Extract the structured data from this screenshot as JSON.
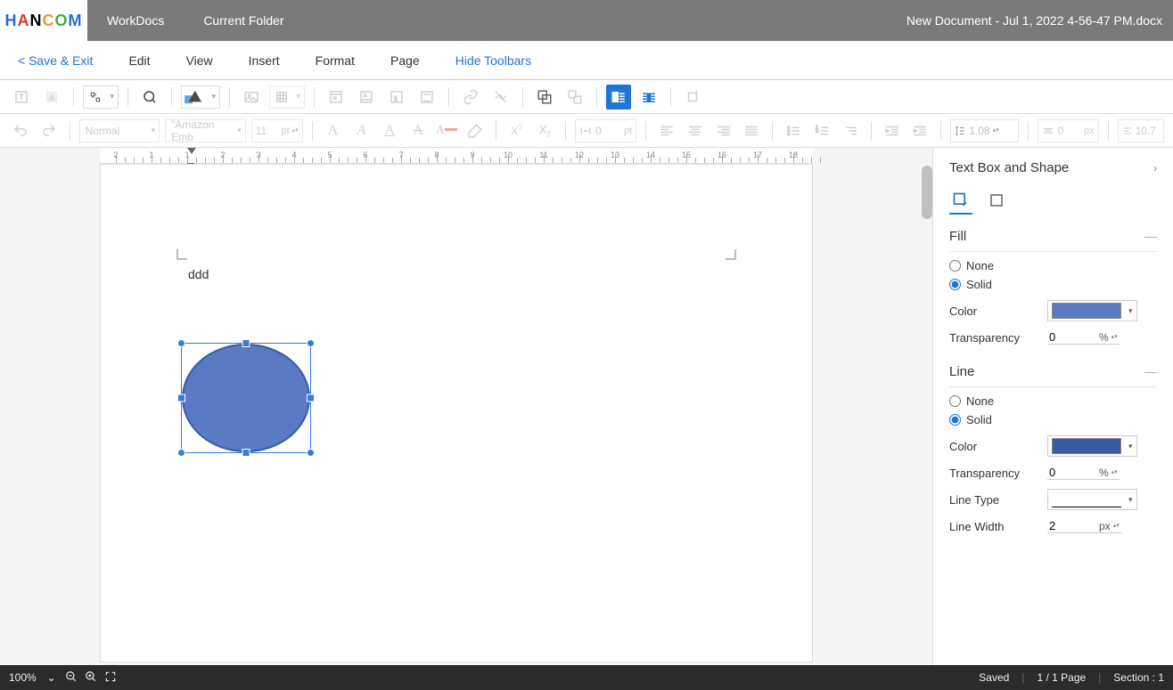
{
  "titlebar": {
    "workdocs": "WorkDocs",
    "current_folder": "Current Folder",
    "doc_title": "New Document - Jul 1, 2022 4-56-47 PM.docx"
  },
  "menubar": {
    "save_exit": "< Save & Exit",
    "edit": "Edit",
    "view": "View",
    "insert": "Insert",
    "format": "Format",
    "page": "Page",
    "hide_toolbars": "Hide Toolbars"
  },
  "toolbar2": {
    "style": "Normal",
    "font": "\"Amazon Emb",
    "size": "11",
    "size_unit": "pt",
    "letter_spacing": "0",
    "ls_unit": "pt",
    "line_height": "1.08",
    "indent": "0",
    "indent_unit": "px",
    "right_val": "10.7"
  },
  "document": {
    "text": "ddd"
  },
  "sidepanel": {
    "title": "Text Box and Shape",
    "fill": {
      "heading": "Fill",
      "none": "None",
      "solid": "Solid",
      "color_label": "Color",
      "color_value": "#5a7bc4",
      "transparency_label": "Transparency",
      "transparency_value": "0",
      "transparency_unit": "%"
    },
    "line": {
      "heading": "Line",
      "none": "None",
      "solid": "Solid",
      "color_label": "Color",
      "color_value": "#3a5ba4",
      "transparency_label": "Transparency",
      "transparency_value": "0",
      "transparency_unit": "%",
      "line_type_label": "Line Type",
      "line_width_label": "Line Width",
      "line_width_value": "2",
      "line_width_unit": "px"
    }
  },
  "statusbar": {
    "zoom": "100%",
    "saved": "Saved",
    "page": "1 / 1 Page",
    "section": "Section :  1"
  },
  "ruler_labels": [
    "2",
    "1",
    "1",
    "2",
    "3",
    "4",
    "5",
    "6",
    "7",
    "8",
    "9",
    "10",
    "11",
    "12",
    "13",
    "14",
    "15",
    "16",
    "17",
    "18"
  ]
}
